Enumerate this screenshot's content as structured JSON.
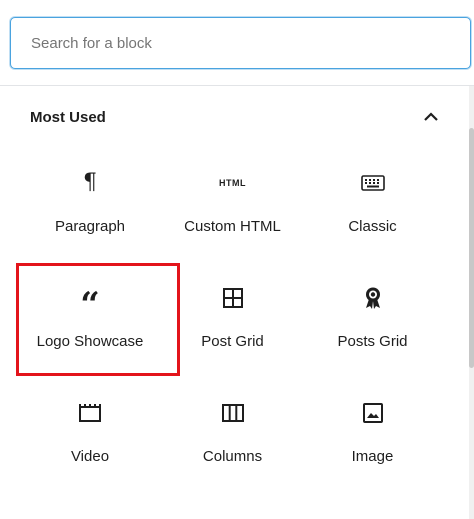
{
  "search": {
    "placeholder": "Search for a block"
  },
  "panel": {
    "title": "Most Used",
    "toggle_icon": "chevron-up-icon"
  },
  "colors": {
    "accent": "#4aa3df",
    "highlight": "#e3141b"
  },
  "blocks": [
    {
      "label": "Paragraph",
      "icon": "paragraph-icon"
    },
    {
      "label": "Custom HTML",
      "icon": "html-icon",
      "icon_text": "HTML"
    },
    {
      "label": "Classic",
      "icon": "keyboard-icon"
    },
    {
      "label": "Logo Showcase",
      "icon": "quote-icon",
      "highlighted": true
    },
    {
      "label": "Post Grid",
      "icon": "grid-icon"
    },
    {
      "label": "Posts Grid",
      "icon": "award-icon"
    },
    {
      "label": "Video",
      "icon": "video-icon"
    },
    {
      "label": "Columns",
      "icon": "columns-icon"
    },
    {
      "label": "Image",
      "icon": "image-icon"
    }
  ]
}
